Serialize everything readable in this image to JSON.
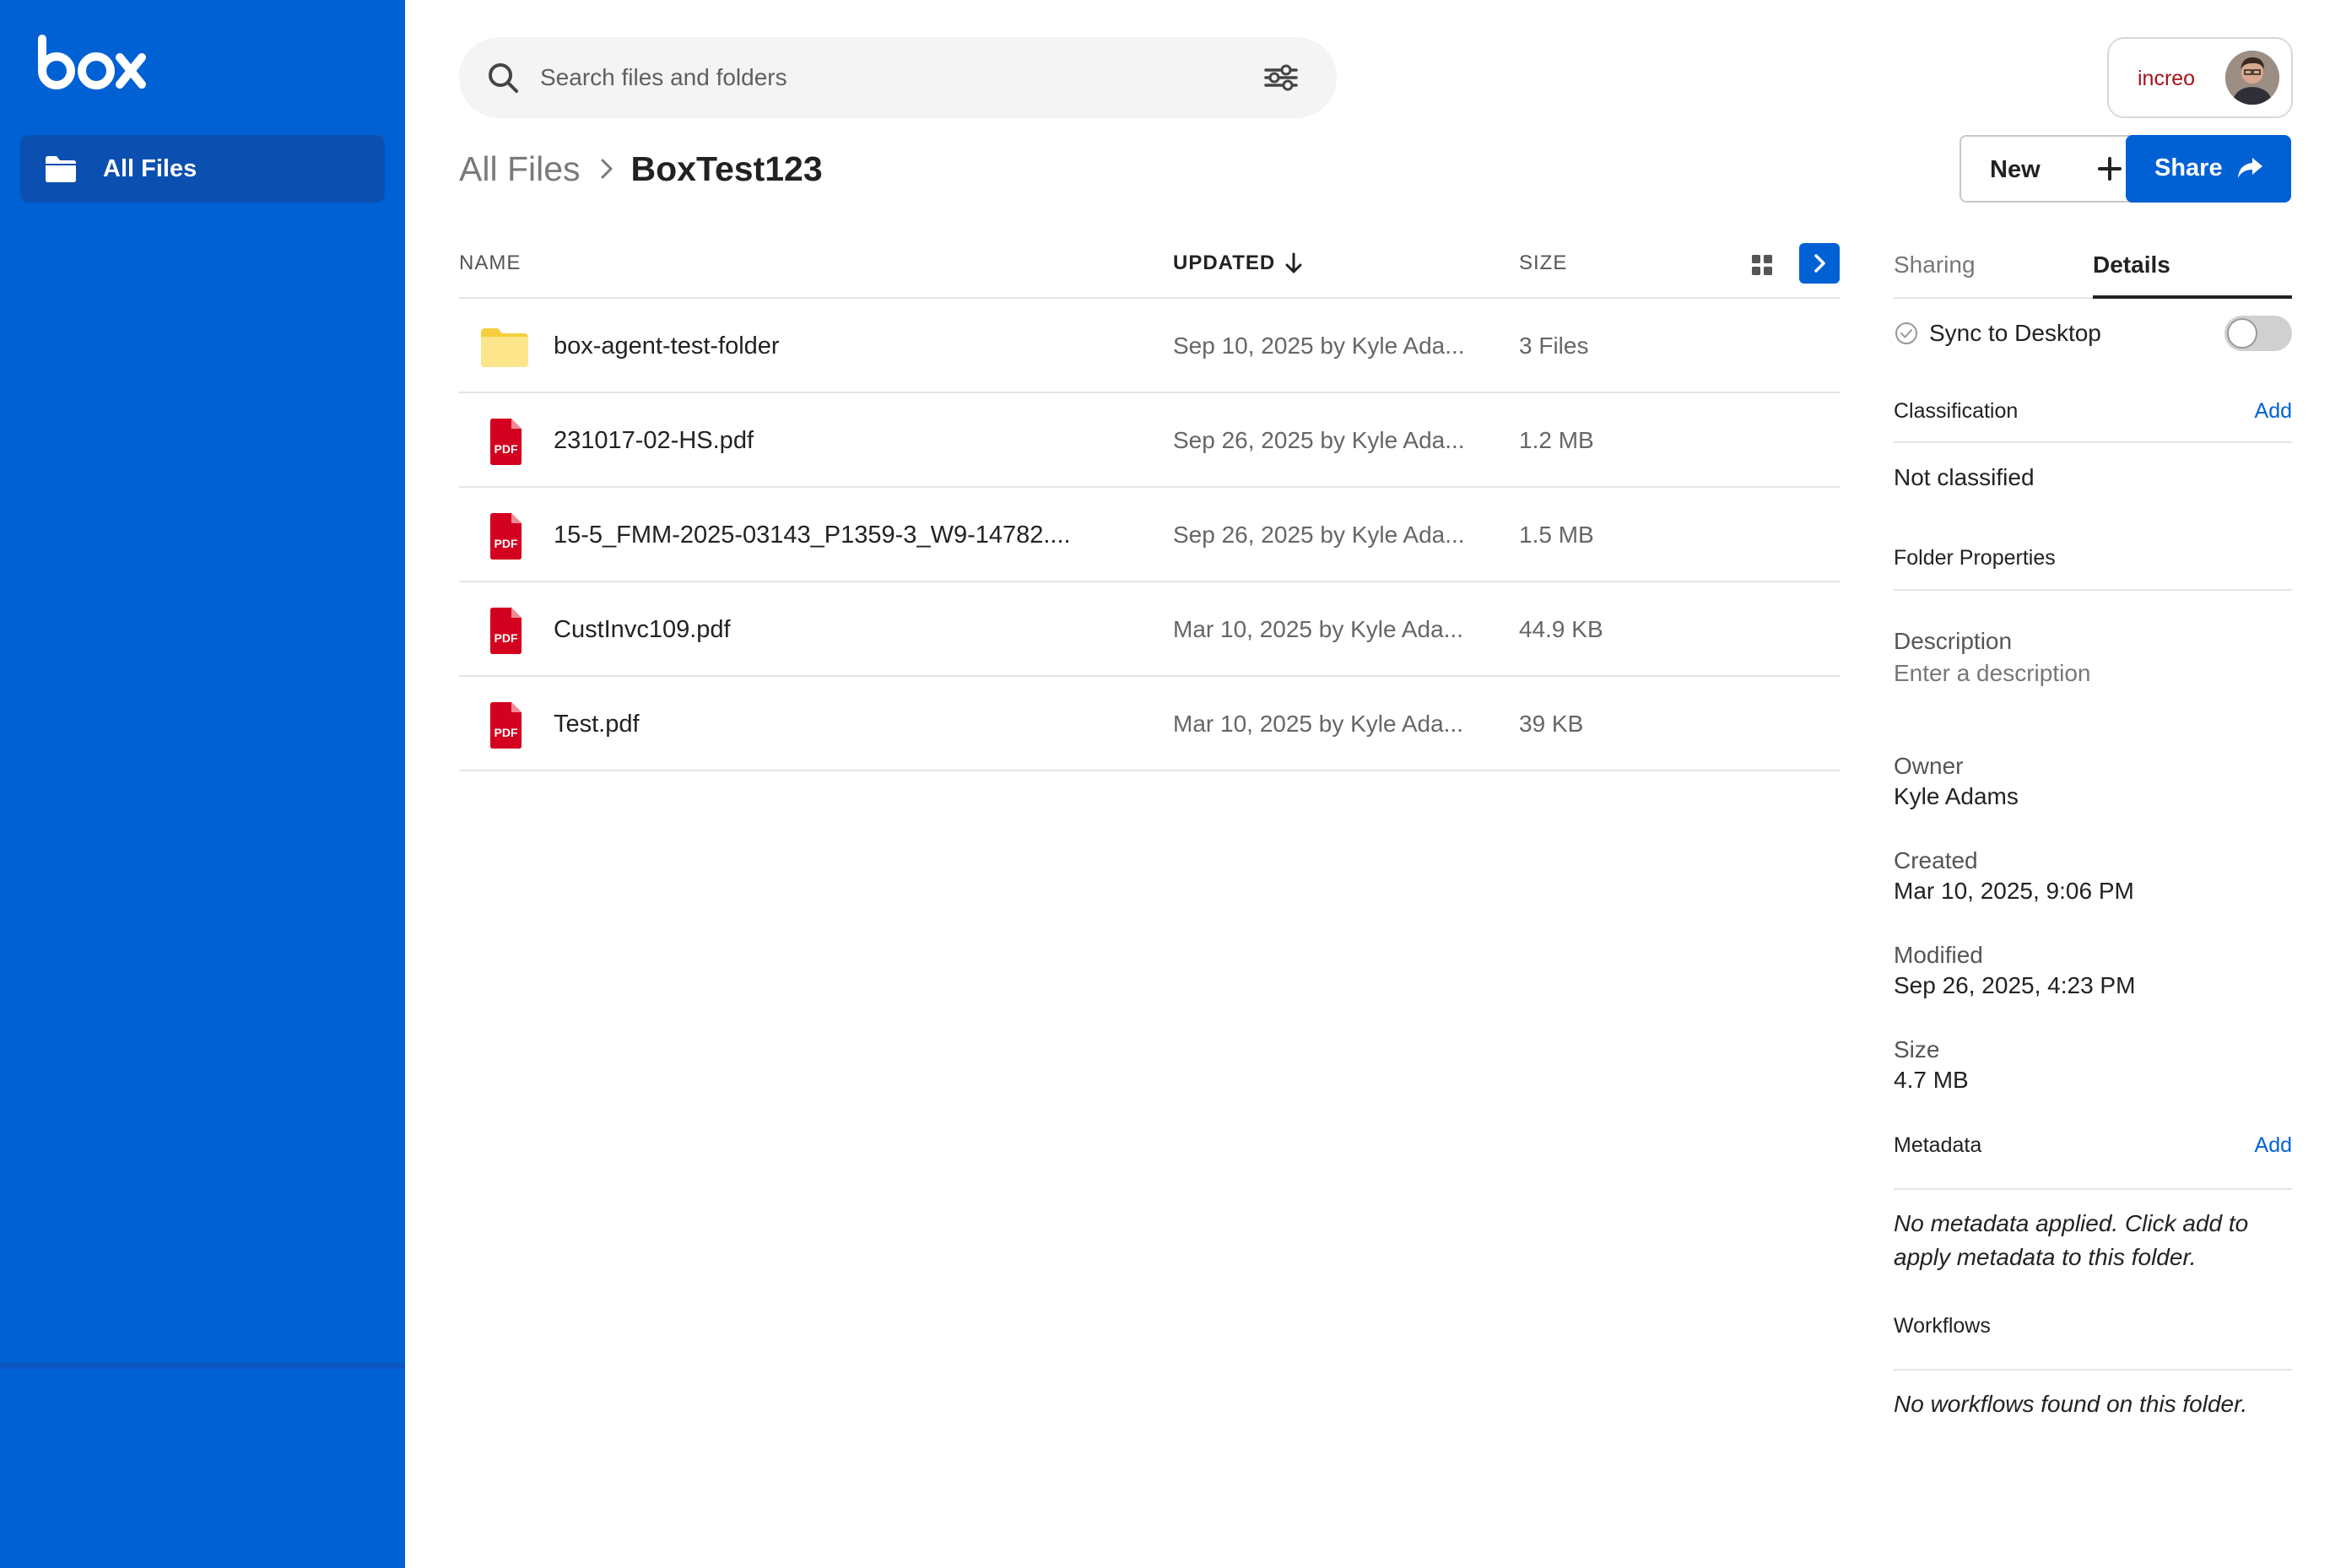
{
  "sidebar": {
    "logo_text": "box",
    "nav_items": [
      {
        "label": "All Files",
        "icon": "folder-icon"
      }
    ]
  },
  "search": {
    "placeholder": "Search files and folders"
  },
  "account": {
    "brand": "increo"
  },
  "breadcrumb": {
    "root": "All Files",
    "current": "BoxTest123"
  },
  "actions": {
    "new_label": "New",
    "share_label": "Share"
  },
  "table": {
    "columns": {
      "name": "NAME",
      "updated": "UPDATED",
      "size": "SIZE"
    },
    "rows": [
      {
        "name": "box-agent-test-folder",
        "updated": "Sep 10, 2025 by Kyle Ada...",
        "size": "3 Files",
        "type": "folder"
      },
      {
        "name": "231017-02-HS.pdf",
        "updated": "Sep 26, 2025 by Kyle Ada...",
        "size": "1.2 MB",
        "type": "pdf"
      },
      {
        "name": "15-5_FMM-2025-03143_P1359-3_W9-14782....",
        "updated": "Sep 26, 2025 by Kyle Ada...",
        "size": "1.5 MB",
        "type": "pdf"
      },
      {
        "name": "CustInvc109.pdf",
        "updated": "Mar 10, 2025 by Kyle Ada...",
        "size": "44.9 KB",
        "type": "pdf"
      },
      {
        "name": "Test.pdf",
        "updated": "Mar 10, 2025 by Kyle Ada...",
        "size": "39 KB",
        "type": "pdf"
      }
    ],
    "pdf_badge": "PDF"
  },
  "panel": {
    "tabs": {
      "sharing": "Sharing",
      "details": "Details"
    },
    "sync_label": "Sync to Desktop",
    "sync_enabled": false,
    "classification": {
      "title": "Classification",
      "add": "Add",
      "value": "Not classified"
    },
    "folder_properties": {
      "title": "Folder Properties"
    },
    "description": {
      "label": "Description",
      "placeholder": "Enter a description"
    },
    "owner": {
      "label": "Owner",
      "value": "Kyle Adams"
    },
    "created": {
      "label": "Created",
      "value": "Mar 10, 2025, 9:06 PM"
    },
    "modified": {
      "label": "Modified",
      "value": "Sep 26, 2025, 4:23 PM"
    },
    "size": {
      "label": "Size",
      "value": "4.7 MB"
    },
    "metadata": {
      "title": "Metadata",
      "add": "Add",
      "empty_line1": "No metadata applied. Click add to",
      "empty_line2": "apply metadata to this folder."
    },
    "workflows": {
      "title": "Workflows",
      "empty": "No workflows found on this folder."
    }
  },
  "colors": {
    "brand_blue": "#0061d5",
    "pdf_red": "#d3001f",
    "folder_yellow": "#f7d64a"
  }
}
